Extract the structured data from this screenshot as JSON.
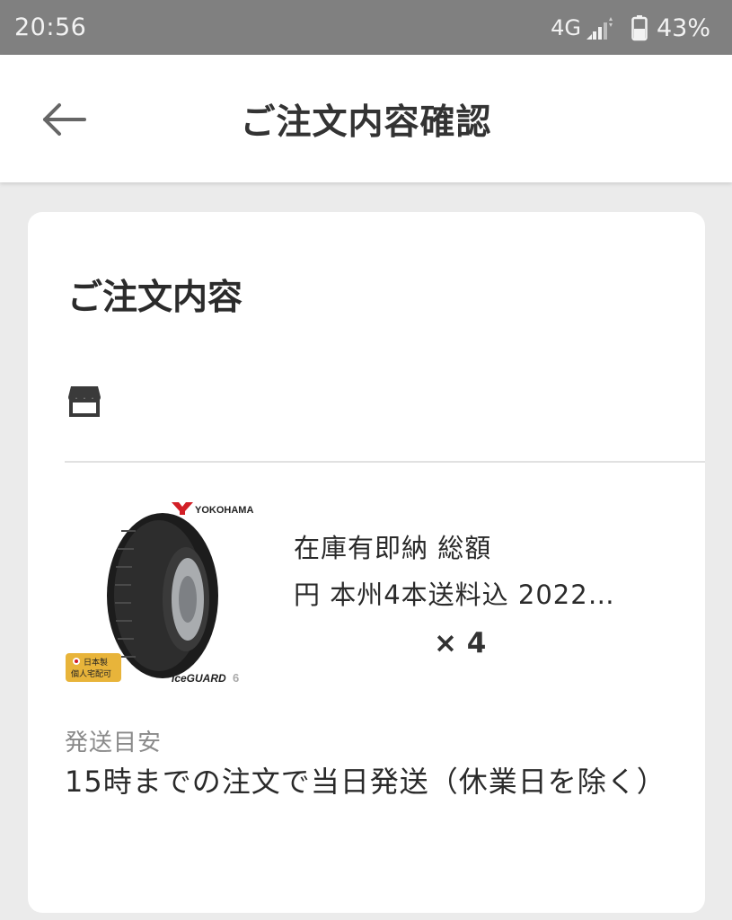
{
  "status_bar": {
    "time": "20:56",
    "network": "4G",
    "battery": "43%"
  },
  "header": {
    "title": "ご注文内容確認",
    "back_icon": "arrow-left-icon"
  },
  "order": {
    "section_title": "ご注文内容",
    "store_icon": "store-icon",
    "item": {
      "title_line1": "在庫有即納  総額",
      "title_line2": "円  本州4本送料込  2022…",
      "quantity": "× 4",
      "image": {
        "brand": "YOKOHAMA",
        "product": "iceGUARD",
        "model_mark": "6",
        "badge_line1": "日本製",
        "badge_line2": "個人宅配可"
      }
    },
    "shipping": {
      "label": "発送目安",
      "value": "15時までの注文で当日発送（休業日を除く）"
    }
  },
  "colors": {
    "status_bar_bg": "#808080",
    "page_bg": "#ebebeb",
    "card_bg": "#ffffff",
    "badge_bg": "#e8b43a"
  }
}
